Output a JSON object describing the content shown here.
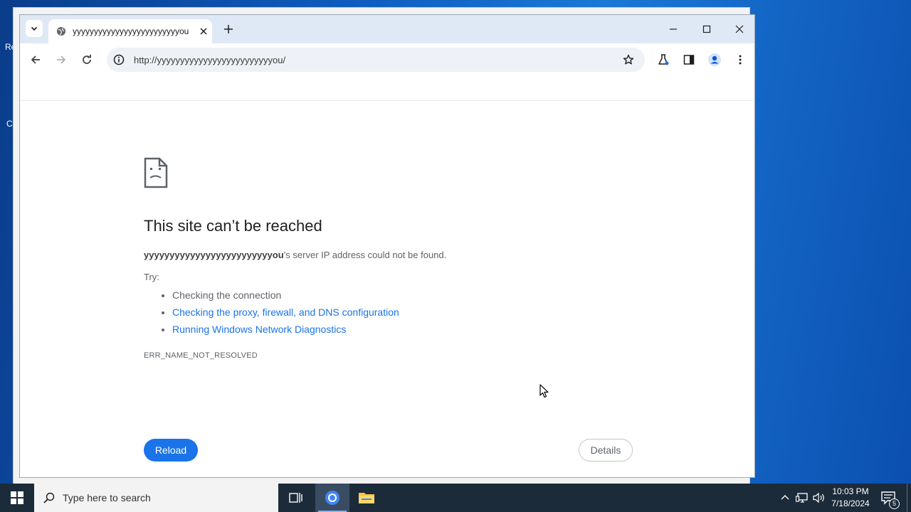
{
  "desktop": {
    "fragments": [
      "Re",
      "C"
    ]
  },
  "browser": {
    "tab": {
      "title": "yyyyyyyyyyyyyyyyyyyyyyyyyou",
      "icon": "globe-icon"
    },
    "address": {
      "url": "http://yyyyyyyyyyyyyyyyyyyyyyyyyou/"
    }
  },
  "error_page": {
    "heading": "This site can’t be reached",
    "host": "yyyyyyyyyyyyyyyyyyyyyyyyyou",
    "description_rest": "’s server IP address could not be found.",
    "try_label": "Try:",
    "suggestions": [
      "Checking the connection",
      "Checking the proxy, firewall, and DNS configuration",
      "Running Windows Network Diagnostics"
    ],
    "error_code": "ERR_NAME_NOT_RESOLVED",
    "reload_label": "Reload",
    "details_label": "Details"
  },
  "taskbar": {
    "search_placeholder": "Type here to search",
    "time": "10:03 PM",
    "date": "7/18/2024",
    "notification_count": "5"
  },
  "colors": {
    "accent": "#1a73e8",
    "link": "#1a73e8",
    "taskbar": "#1c2b3a"
  }
}
